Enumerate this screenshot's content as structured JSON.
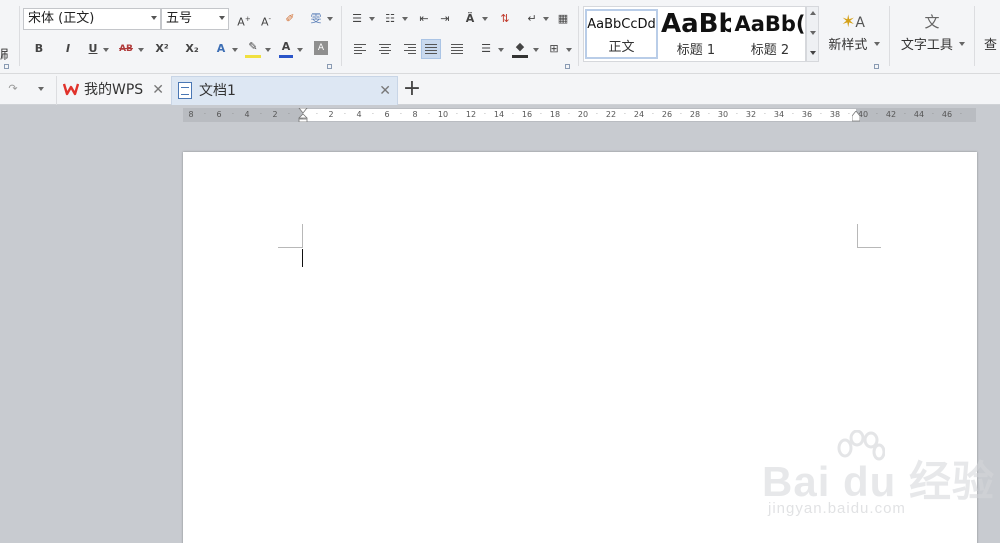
{
  "ribbon": {
    "clipped_left_label": "刷",
    "font_name": "宋体 (正文)",
    "font_size": "五号",
    "style_gallery": [
      {
        "sample": "AaBbCcDd",
        "name": "正文"
      },
      {
        "sample": "AaBb",
        "name": "标题 1"
      },
      {
        "sample": "AaBb(",
        "name": "标题 2"
      }
    ],
    "new_style_label": "新样式",
    "text_tools_label": "文字工具",
    "clipped_right_label": "查",
    "format_buttons": {
      "bold": "B",
      "italic": "I",
      "underline": "U",
      "strikethrough": "AB",
      "superscript": "X²",
      "subscript": "X₂"
    },
    "pinyin_glyph": "雯"
  },
  "tabs": {
    "home_label": "我的WPS",
    "document_label": "文档1",
    "add_glyph": "+"
  },
  "ruler": {
    "left_numbers": [
      "8",
      "6",
      "4",
      "2"
    ],
    "right_numbers": [
      "2",
      "4",
      "6",
      "8",
      "10",
      "12",
      "14",
      "16",
      "18",
      "20",
      "22",
      "24",
      "26",
      "28",
      "30",
      "32",
      "34",
      "36",
      "38",
      "40",
      "42",
      "44",
      "46"
    ]
  },
  "watermark": {
    "brand": "Bai du 经验",
    "url": "jingyan.baidu.com"
  },
  "colors": {
    "accent": "#4a77b4",
    "wps_red": "#e0322b",
    "background": "#c8cbd0",
    "ribbon": "#f4f5f7"
  }
}
